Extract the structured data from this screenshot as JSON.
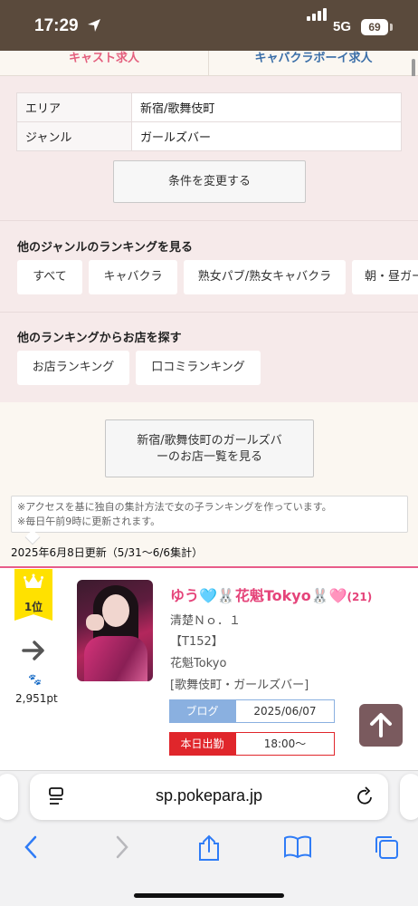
{
  "status_bar": {
    "time": "17:29",
    "network": "5G",
    "battery": "69"
  },
  "top_tabs": {
    "left": "キャスト求人",
    "right": "キャバクラボーイ求人"
  },
  "conditions": {
    "rows": [
      {
        "key": "エリア",
        "value": "新宿/歌舞伎町"
      },
      {
        "key": "ジャンル",
        "value": "ガールズバー"
      }
    ],
    "change_button": "条件を変更する"
  },
  "other_genre": {
    "title": "他のジャンルのランキングを見る",
    "chips": [
      "すべて",
      "キャバクラ",
      "熟女パブ/熟女キャバクラ",
      "朝・昼ガー"
    ]
  },
  "other_ranking": {
    "title": "他のランキングからお店を探す",
    "chips": [
      "お店ランキング",
      "口コミランキング"
    ]
  },
  "shop_list_button": {
    "line1": "新宿/歌舞伎町のガールズバ",
    "line2": "ーのお店一覧を見る"
  },
  "notice": {
    "line1": "※アクセスを基に独自の集計方法で女の子ランキングを作っています。",
    "line2": "※毎日午前9時に更新されます。"
  },
  "updated": "2025年6月8日更新（5/31〜6/6集計）",
  "ranking": {
    "rank_label": "1位",
    "points": "2,951pt",
    "paw": "🐾",
    "name": "ゆう🩵🐰花魁Tokyo🐰🩷",
    "age": "(21)",
    "catch": "清楚Ｎｏ．１",
    "height": "【T152】",
    "shop": "花魁Tokyo",
    "area_genre": "[歌舞伎町・ガールズバー]",
    "blog_label": "ブログ",
    "blog_date": "2025/06/07",
    "shift_label": "本日出勤",
    "shift_time": "18:00〜"
  },
  "browser": {
    "url": "sp.pokepara.jp"
  },
  "icons": [
    "location-arrow-icon",
    "signal-icon",
    "battery-icon",
    "crown-icon",
    "right-arrow-icon",
    "paw-icon",
    "scroll-top-icon",
    "tabs-overview-icon",
    "reload-icon",
    "back-icon",
    "forward-icon",
    "share-icon",
    "bookmarks-icon",
    "tabs-icon"
  ],
  "colors": {
    "accent_pink": "#e5447a",
    "blog_blue": "#8ab0e0",
    "shift_red": "#e0262b",
    "rank_gold": "#ffe100"
  }
}
